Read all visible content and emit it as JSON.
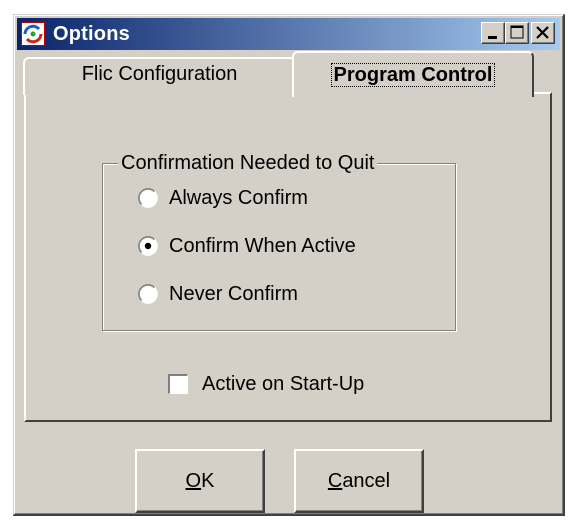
{
  "window": {
    "title": "Options",
    "controls": {
      "minimize_icon": "minimize-icon",
      "maximize_icon": "maximize-icon",
      "close_icon": "close-icon"
    }
  },
  "tabs": [
    {
      "label": "Flic Configuration",
      "active": false
    },
    {
      "label": "Program Control",
      "active": true
    }
  ],
  "confirm_group": {
    "legend": "Confirmation Needed to Quit",
    "options": [
      {
        "label": "Always Confirm",
        "selected": false
      },
      {
        "label": "Confirm When Active",
        "selected": true
      },
      {
        "label": "Never Confirm",
        "selected": false
      }
    ]
  },
  "startup": {
    "label": "Active on Start-Up",
    "checked": false
  },
  "buttons": {
    "ok": {
      "mnemonic": "O",
      "rest": "K"
    },
    "cancel": {
      "mnemonic": "C",
      "rest": "ancel"
    }
  }
}
